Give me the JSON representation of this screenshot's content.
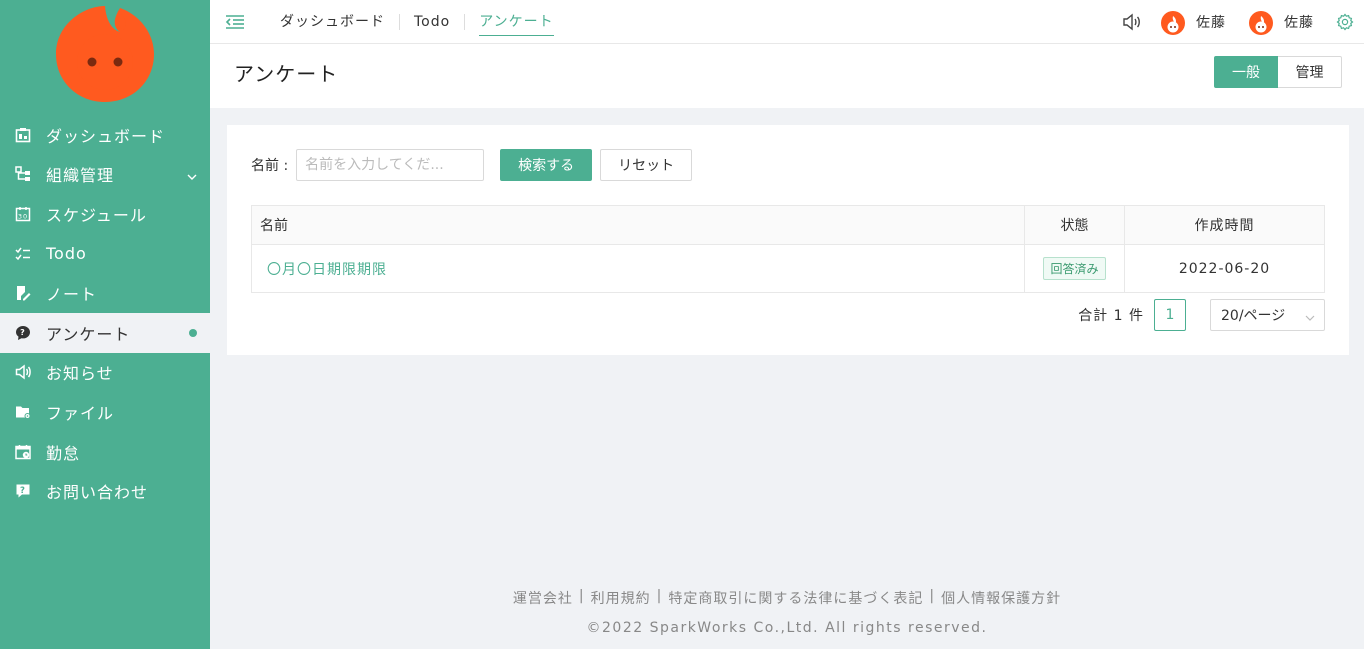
{
  "sidebar": {
    "items": [
      {
        "label": "ダッシュボード",
        "icon": "dashboard-icon"
      },
      {
        "label": "組織管理",
        "icon": "org-icon"
      },
      {
        "label": "スケジュール",
        "icon": "calendar-icon"
      },
      {
        "label": "Todo",
        "icon": "checklist-icon"
      },
      {
        "label": "ノート",
        "icon": "note-icon"
      },
      {
        "label": "アンケート",
        "icon": "survey-icon"
      },
      {
        "label": "お知らせ",
        "icon": "speaker-icon"
      },
      {
        "label": "ファイル",
        "icon": "folder-icon"
      },
      {
        "label": "勤怠",
        "icon": "attendance-icon"
      },
      {
        "label": "お問い合わせ",
        "icon": "inquiry-icon"
      }
    ]
  },
  "topbar": {
    "tabs": [
      {
        "label": "ダッシュボード"
      },
      {
        "label": "Todo"
      },
      {
        "label": "アンケート"
      }
    ],
    "users": [
      {
        "name": "佐藤"
      },
      {
        "name": "佐藤"
      }
    ]
  },
  "header": {
    "title": "アンケート",
    "seg_general": "一般",
    "seg_admin": "管理"
  },
  "search": {
    "label": "名前 :",
    "placeholder": "名前を入力してくだ...",
    "search_button": "検索する",
    "reset_button": "リセット"
  },
  "table": {
    "headers": {
      "name": "名前",
      "status": "状態",
      "created": "作成時間"
    },
    "rows": [
      {
        "name": "〇月〇日期限期限",
        "status": "回答済み",
        "created": "2022-06-20"
      }
    ]
  },
  "pagination": {
    "total": "合計 1 件",
    "current_page": "1",
    "page_size": "20/ページ"
  },
  "footer": {
    "links": [
      "運営会社",
      "利用規約",
      "特定商取引に関する法律に基づく表記",
      "個人情報保護方針"
    ],
    "copyright": "©2022 SparkWorks Co.,Ltd. All rights reserved."
  },
  "colors": {
    "accent": "#4caf92",
    "brand_orange": "#ff5a1f"
  }
}
